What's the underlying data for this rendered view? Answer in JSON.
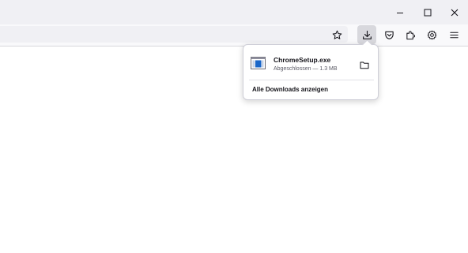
{
  "window_controls": {
    "minimize_icon": "minimize-icon",
    "maximize_icon": "maximize-icon",
    "close_icon": "close-icon"
  },
  "toolbar": {
    "bookmark_icon": "star-icon",
    "downloads_icon": "download-icon",
    "pocket_icon": "pocket-icon",
    "extensions_icon": "puzzle-icon",
    "settings_icon": "gear-icon",
    "menu_icon": "hamburger-menu-icon"
  },
  "downloads_panel": {
    "items": [
      {
        "filename": "ChromeSetup.exe",
        "status": "Abgeschlossen — 1.3 MB",
        "file_icon": "exe-file-icon",
        "folder_icon": "folder-icon"
      }
    ],
    "show_all_label": "Alle Downloads anzeigen"
  },
  "colors": {
    "accent_blue": "#1a66c8",
    "titlebar": "#f0f0f4",
    "toolbar": "#f9f9fb"
  }
}
